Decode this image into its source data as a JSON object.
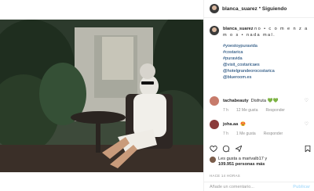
{
  "post": {
    "username": "blanca_suarez",
    "follow_label": "Siguiendo",
    "caption_text": "no • c o m e n z a m o s • nada mal.",
    "hashtags": [
      "#yoestoypuravida",
      "#costarica",
      "#puravida",
      "@visit_costaricaes",
      "@hotelgrandeorocostarica",
      "@blueroom.es"
    ]
  },
  "comments": [
    {
      "user": "tachabeauty",
      "text": "Disfruta 💚💚",
      "time": "7 h",
      "likes": "12 Me gusta",
      "reply": "Responder"
    },
    {
      "user": "joha.aa",
      "text": "😍",
      "time": "7 h",
      "likes": "1 Me gusta",
      "reply": "Responder"
    }
  ],
  "likes": {
    "line1": "Les gusta a marivalb17 y",
    "line2": "109.951 personas más"
  },
  "date": "HACE 14 HORAS",
  "comment_input": {
    "placeholder": "Añade un comentario..."
  },
  "publish_label": "Publicar",
  "icons": [
    "heart-icon",
    "comment-icon",
    "share-icon",
    "bookmark-icon"
  ]
}
